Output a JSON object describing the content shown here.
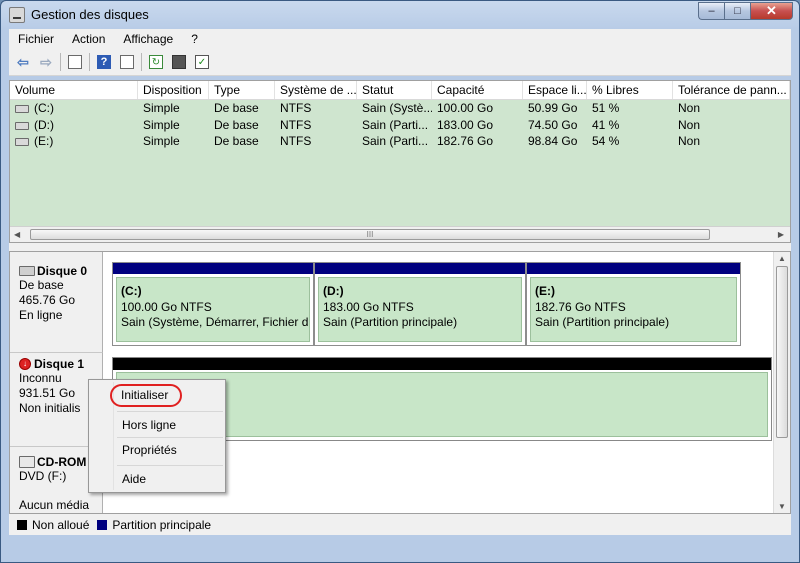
{
  "window": {
    "title": "Gestion des disques",
    "min": "–",
    "max": "□",
    "close": "✕"
  },
  "menu": [
    "Fichier",
    "Action",
    "Affichage",
    "?"
  ],
  "toolbar_icons": [
    "back-arrow-icon",
    "forward-arrow-icon",
    "console-tree-icon",
    "help-icon",
    "properties-icon",
    "refresh-icon",
    "export-icon",
    "checklist-icon"
  ],
  "volumes": {
    "columns": [
      "Volume",
      "Disposition",
      "Type",
      "Système de ...",
      "Statut",
      "Capacité",
      "Espace li...",
      "% Libres",
      "Tolérance de pann..."
    ],
    "rows": [
      [
        "(C:)",
        "Simple",
        "De base",
        "NTFS",
        "Sain (Systè...",
        "100.00 Go",
        "50.99 Go",
        "51 %",
        "Non"
      ],
      [
        "(D:)",
        "Simple",
        "De base",
        "NTFS",
        "Sain (Parti...",
        "183.00 Go",
        "74.50 Go",
        "41 %",
        "Non"
      ],
      [
        "(E:)",
        "Simple",
        "De base",
        "NTFS",
        "Sain (Parti...",
        "182.76 Go",
        "98.84 Go",
        "54 %",
        "Non"
      ]
    ],
    "hscroll_grip": "III"
  },
  "disk0": {
    "name": "Disque 0",
    "type": "De base",
    "size": "465.76 Go",
    "status": "En ligne",
    "partitions": [
      {
        "name": "(C:)",
        "size": "100.00 Go NTFS",
        "status": "Sain (Système, Démarrer, Fichier d'éc"
      },
      {
        "name": "(D:)",
        "size": "183.00 Go NTFS",
        "status": "Sain (Partition principale)"
      },
      {
        "name": "(E:)",
        "size": "182.76 Go NTFS",
        "status": "Sain (Partition principale)"
      }
    ]
  },
  "disk1": {
    "name": "Disque 1",
    "type": "Inconnu",
    "size": "931.51 Go",
    "status": "Non initialis"
  },
  "cdrom": {
    "name": "CD-ROM",
    "drive": "DVD (F:)",
    "status": "Aucun média"
  },
  "legend": {
    "unallocated": "Non alloué",
    "primary": "Partition principale"
  },
  "context_menu": {
    "initialize": "Initialiser",
    "offline": "Hors ligne",
    "properties": "Propriétés",
    "help": "Aide"
  },
  "colors": {
    "primary_partition": "#00007f",
    "unallocated": "#000000",
    "partition_fill": "#c8e6c8",
    "highlight": "#e02020"
  }
}
